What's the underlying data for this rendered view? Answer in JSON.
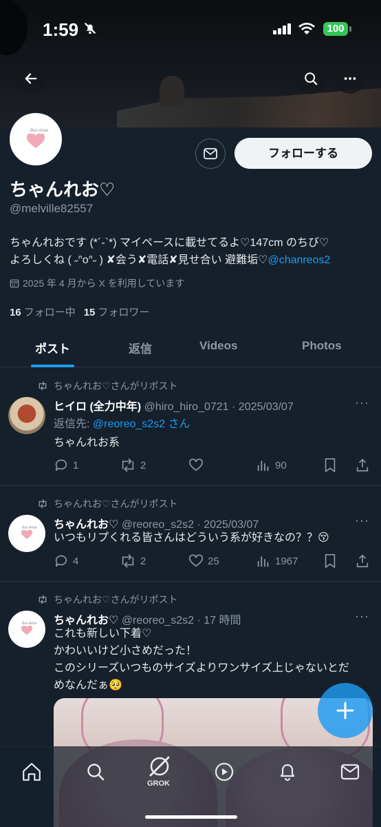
{
  "status_bar": {
    "time": "1:59",
    "battery": "100"
  },
  "profile": {
    "name": "ちゃんれお♡",
    "handle": "@melville82557",
    "bio_text": "ちゃんれおです (*´-`*) マイペースに載せてるよ♡147cm のちび♡",
    "bio_text_2": "よろしくね ( ˶ᐢoᐢ˶ ) ✘会う✘電話✘見せ合い 避難垢♡",
    "bio_link": "@chanreos2",
    "joined": "2025 年 4 月から X を利用しています",
    "following_count": "16",
    "following_label": "フォロー中",
    "followers_count": "15",
    "followers_label": "フォロワー",
    "follow_button": "フォローする",
    "avatar_script": "Bon Amie"
  },
  "tabs": [
    {
      "label": "ポスト",
      "active": true
    },
    {
      "label": "返信",
      "active": false
    },
    {
      "label": "Videos",
      "active": false
    },
    {
      "label": "Photos",
      "active": false
    }
  ],
  "tweets": [
    {
      "retweeted_by": "ちゃんれお♡さんがリポスト",
      "name": "ヒイロ (全力中年)",
      "meta": "@hiro_hiro_0721 · 2025/03/07",
      "reply_prefix": "返信先: ",
      "reply_handle": "@reoreo_s2s2 さん",
      "text": "ちゃんれお系",
      "replies": "1",
      "retweets": "2",
      "likes": "",
      "views": "90"
    },
    {
      "retweeted_by": "ちゃんれお♡さんがリポスト",
      "name": "ちゃんれお♡",
      "meta": "@reoreo_s2s2 · 2025/03/07",
      "text": "いつもリプくれる皆さんはどういう系が好きなの？？😚",
      "replies": "4",
      "retweets": "2",
      "likes": "25",
      "views": "1967"
    },
    {
      "retweeted_by": "ちゃんれお♡さんがリポスト",
      "name": "ちゃんれお♡",
      "meta": "@reoreo_s2s2 · 17 時間",
      "text_lines": [
        "これも新しい下着♡",
        "かわいいけど小さめだった！",
        "このシリーズいつものサイズよりワンサイズ上じゃないとだ",
        "めなんだぁ🥺"
      ]
    }
  ],
  "bottom_nav": {
    "grok_label": "GROK"
  },
  "colors": {
    "background": "#15202b",
    "accent": "#1d9bf0",
    "battery": "#34c759"
  },
  "icons": [
    "back-arrow-icon",
    "search-icon",
    "more-icon",
    "mail-icon",
    "calendar-icon",
    "repost-icon",
    "reply-icon",
    "like-icon",
    "views-icon",
    "bookmark-icon",
    "share-icon",
    "home-icon",
    "grok-icon",
    "play-icon",
    "bell-icon",
    "compose-icon"
  ]
}
